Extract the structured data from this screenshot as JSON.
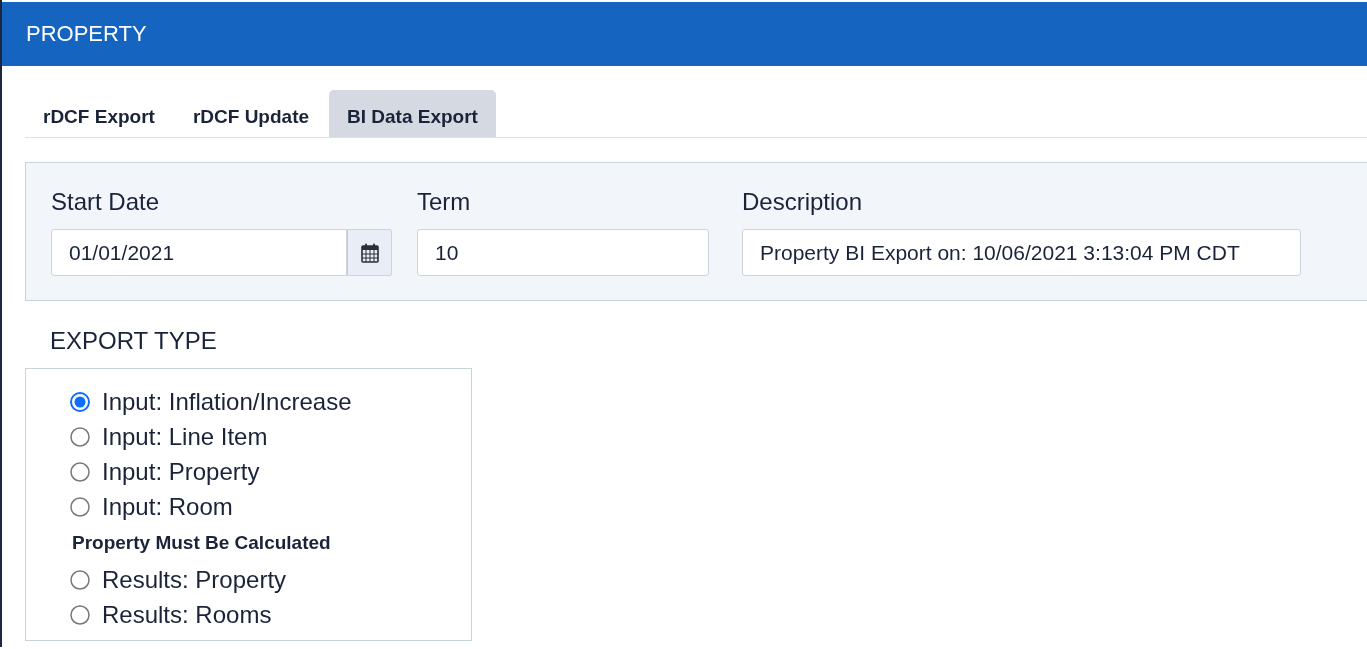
{
  "header": {
    "title": "PROPERTY"
  },
  "tabs": [
    {
      "label": "rDCF Export",
      "selected": false
    },
    {
      "label": "rDCF Update",
      "selected": false
    },
    {
      "label": "BI Data Export",
      "selected": true
    }
  ],
  "filters": {
    "start_date": {
      "label": "Start Date",
      "value": "01/01/2021"
    },
    "term": {
      "label": "Term",
      "value": "10"
    },
    "description": {
      "label": "Description",
      "value": "Property BI Export on: 10/06/2021 3:13:04 PM CDT"
    }
  },
  "export_type": {
    "title": "EXPORT TYPE",
    "groups": [
      {
        "options": [
          {
            "label": "Input: Inflation/Increase",
            "selected": true
          },
          {
            "label": "Input: Line Item",
            "selected": false
          },
          {
            "label": "Input: Property",
            "selected": false
          },
          {
            "label": "Input: Room",
            "selected": false
          }
        ]
      },
      {
        "heading": "Property Must Be Calculated",
        "options": [
          {
            "label": "Results: Property",
            "selected": false
          },
          {
            "label": "Results: Rooms",
            "selected": false
          }
        ]
      }
    ]
  }
}
